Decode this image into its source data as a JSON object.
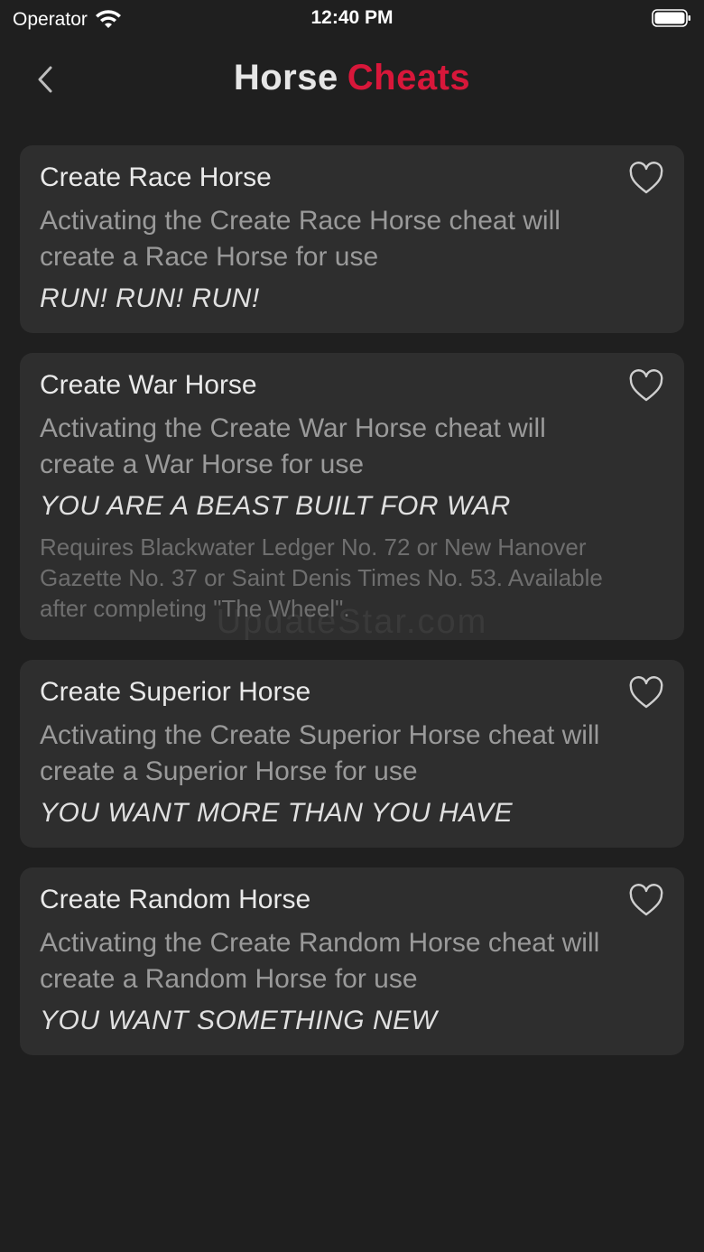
{
  "status_bar": {
    "carrier": "Operator",
    "time": "12:40 PM"
  },
  "nav": {
    "title_part1": "Horse",
    "title_part2": "Cheats"
  },
  "colors": {
    "background": "#1f1f1f",
    "card": "#2e2e2e",
    "accent": "#d8173a"
  },
  "cheats": [
    {
      "title": "Create Race Horse",
      "description": "Activating the Create Race Horse cheat will create a Race Horse for use",
      "code": "RUN! RUN! RUN!",
      "note": ""
    },
    {
      "title": "Create War Horse",
      "description": "Activating the Create War Horse cheat will create a War Horse for use",
      "code": "YOU ARE A BEAST BUILT FOR WAR",
      "note": "Requires Blackwater Ledger No. 72 or New Hanover Gazette No. 37 or Saint Denis Times No. 53. Available after completing \"The Wheel\"."
    },
    {
      "title": "Create Superior Horse",
      "description": "Activating the Create Superior Horse cheat will create a Superior Horse for use",
      "code": "YOU WANT MORE THAN YOU HAVE",
      "note": ""
    },
    {
      "title": "Create Random Horse",
      "description": "Activating the Create Random Horse cheat will create a Random Horse for use",
      "code": "YOU WANT SOMETHING NEW",
      "note": ""
    }
  ],
  "watermark": "UpdateStar.com"
}
